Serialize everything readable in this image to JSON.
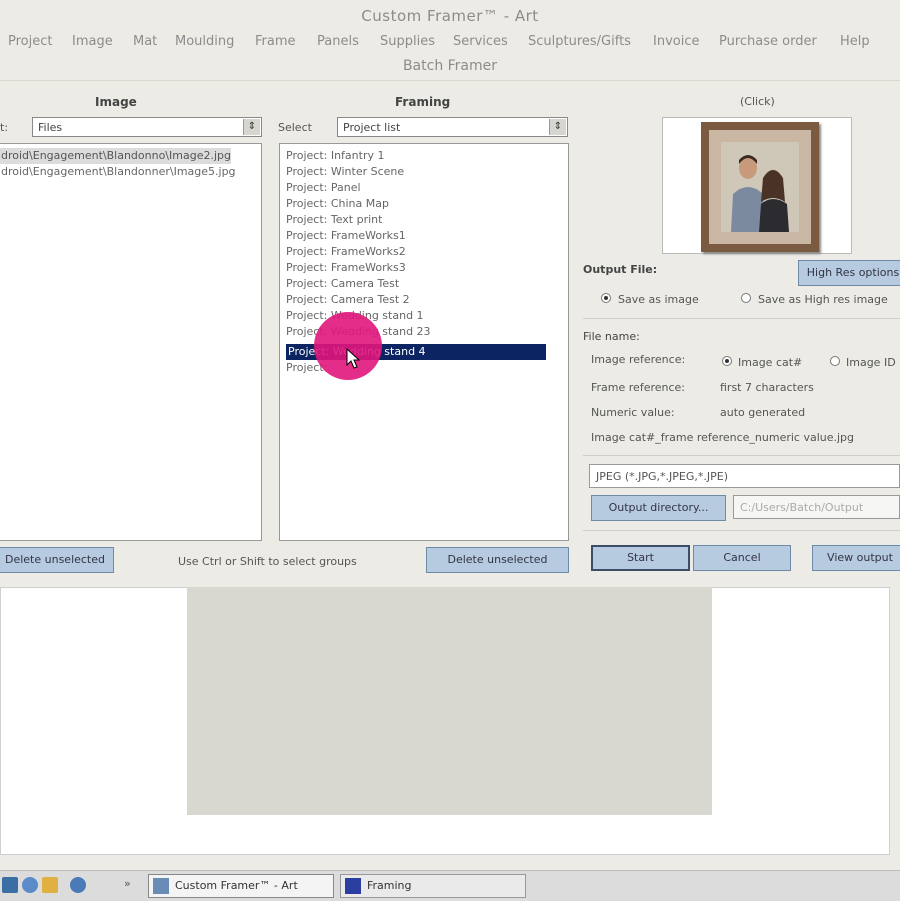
{
  "window": {
    "title": "Custom Framer™ - Art"
  },
  "menu": [
    "Project",
    "Image",
    "Mat",
    "Moulding",
    "Frame",
    "Panels",
    "Supplies",
    "Services",
    "Sculptures/Gifts",
    "Invoice",
    "Purchase order",
    "Help"
  ],
  "dialog": {
    "title": "Batch Framer",
    "image": {
      "header": "Image",
      "select_label": "t:",
      "select_value": "Files",
      "files": [
        "droid\\Engagement\\Blandonno\\Image2.jpg",
        "droid\\Engagement\\Blandonner\\Image5.jpg"
      ],
      "delete_button": "Delete unselected"
    },
    "framing": {
      "header": "Framing",
      "select_label": "Select",
      "select_value": "Project list",
      "projects": [
        "Project: Infantry 1",
        "Project: Winter Scene",
        "Project: Panel",
        "Project: China Map",
        "Project: Text print",
        "Project: FrameWorks1",
        "Project: FrameWorks2",
        "Project: FrameWorks3",
        "Project: Camera Test",
        "Project: Camera Test 2",
        "Project: Wedding stand 1",
        "Project: Wedding stand 23",
        "Project: Wedding stand 4",
        "Project: "
      ],
      "selected_index": 12,
      "hint": "Use Ctrl or Shift to select groups",
      "delete_button": "Delete unselected"
    },
    "preview": {
      "header": "(Click)"
    },
    "output": {
      "header": "Output File:",
      "high_res_button": "High Res options",
      "save_as_image": "Save as image",
      "save_as_high_res": "Save as High res image",
      "file_name_header": "File name:",
      "image_reference_label": "Image reference:",
      "image_reference_opt1": "Image cat#",
      "image_reference_opt2": "Image ID",
      "frame_reference_label": "Frame reference:",
      "frame_reference_value": "first 7 characters",
      "numeric_value_label": "Numeric value:",
      "numeric_value_value": "auto generated",
      "pattern": "Image cat#_frame reference_numeric value.jpg",
      "file_type": "JPEG (*.JPG,*.JPEG,*.JPE)",
      "output_directory_button": "Output directory...",
      "output_directory_value": "C:/Users/Batch/Output"
    },
    "start_button": "Start",
    "cancel_button": "Cancel",
    "view_output_button": "View output"
  },
  "taskbar": {
    "items": [
      "Custom Framer™ - Art",
      "Framing"
    ]
  },
  "colors": {
    "selection": "#0c2461",
    "button": "#b7cbe0",
    "cursor_highlight": "#e0167c"
  }
}
